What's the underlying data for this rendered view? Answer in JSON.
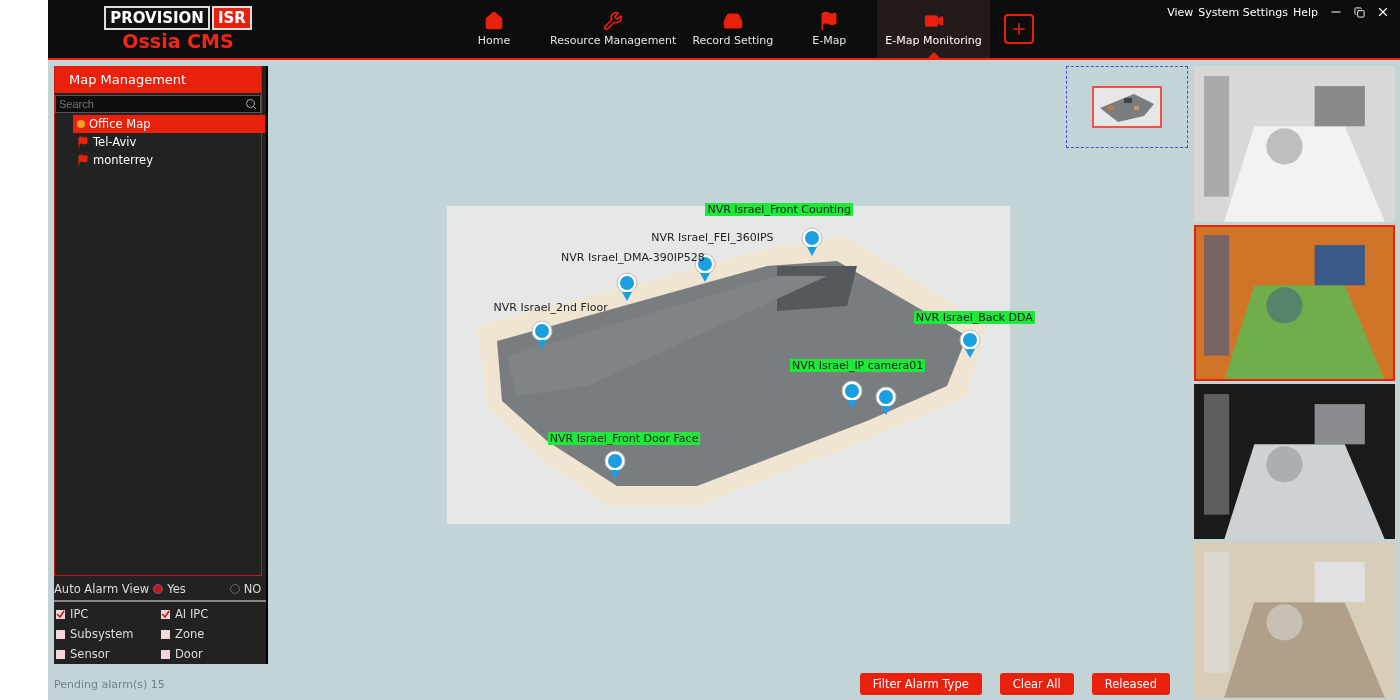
{
  "header": {
    "logo": {
      "brand": "PROVISION",
      "badge": "ISR",
      "product": "Ossia CMS"
    },
    "nav": [
      {
        "label": "Home",
        "selected": false
      },
      {
        "label": "Resource Management",
        "selected": false
      },
      {
        "label": "Record Setting",
        "selected": false
      },
      {
        "label": "E-Map",
        "selected": false
      },
      {
        "label": "E-Map Monitoring",
        "selected": true
      }
    ],
    "menu": [
      "View",
      "System Settings",
      "Help"
    ]
  },
  "sidebar": {
    "title": "Map Management",
    "search": {
      "placeholder": "Search"
    },
    "maps": [
      {
        "label": "Office Map",
        "selected": true
      },
      {
        "label": "Tel-Aviv",
        "selected": false
      },
      {
        "label": "monterrey",
        "selected": false
      }
    ],
    "auto_alarm_view": {
      "label": "Auto Alarm View",
      "options": [
        {
          "label": "Yes",
          "selected": true
        },
        {
          "label": "NO",
          "selected": false
        }
      ]
    },
    "filters": [
      {
        "label": "IPC",
        "checked": true
      },
      {
        "label": "AI IPC",
        "checked": true
      },
      {
        "label": "Subsystem",
        "checked": false
      },
      {
        "label": "Zone",
        "checked": false
      },
      {
        "label": "Sensor",
        "checked": false
      },
      {
        "label": "Door",
        "checked": false
      }
    ],
    "pending": "Pending alarm(s)  15"
  },
  "map": {
    "cameras": [
      {
        "label": "NVR Israel_Front Counting",
        "highlighted": true
      },
      {
        "label": "NVR Israel_FEI_360IPS",
        "highlighted": false
      },
      {
        "label": "NVR Israel_DMA-390IP528",
        "highlighted": false
      },
      {
        "label": "NVR Israel_2nd Floor",
        "highlighted": false
      },
      {
        "label": "NVR Israel_Back DDA",
        "highlighted": true
      },
      {
        "label": "NVR Israel_IP camera01",
        "highlighted": true
      },
      {
        "label": "NVR Israel_Front Door Face",
        "highlighted": true
      }
    ]
  },
  "videos": [
    {
      "selected": false
    },
    {
      "selected": true
    },
    {
      "selected": false
    },
    {
      "selected": false
    }
  ],
  "buttons": [
    "Filter Alarm Type",
    "Clear All",
    "Released"
  ]
}
